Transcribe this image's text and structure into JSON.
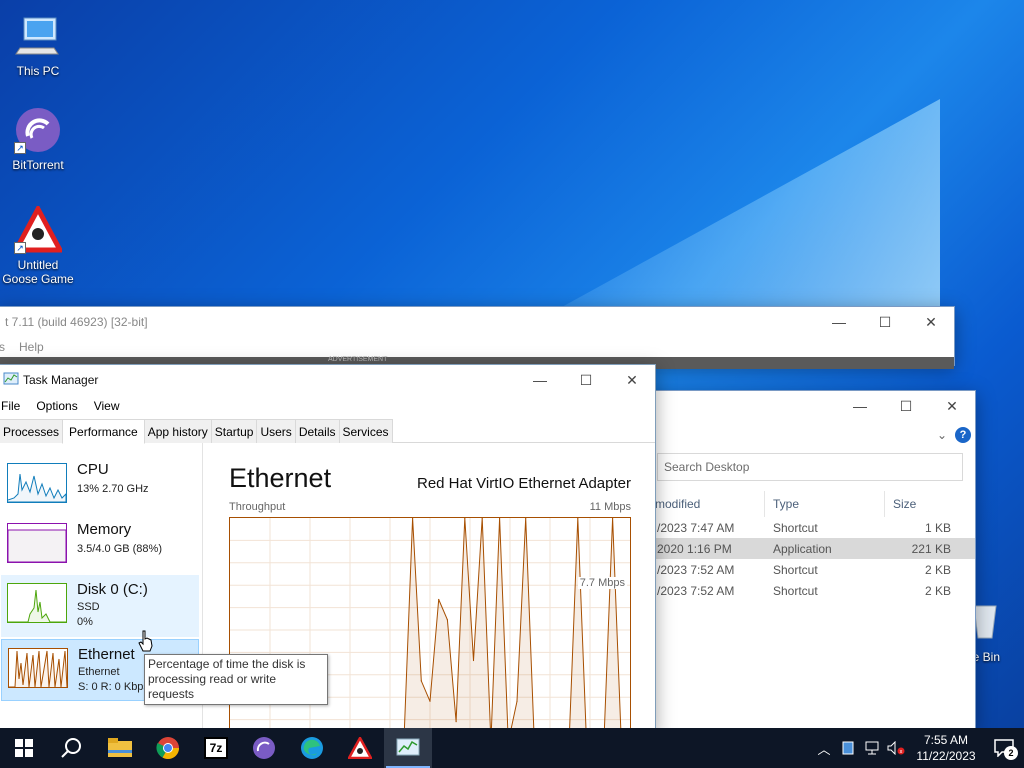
{
  "desktop": {
    "icons": [
      {
        "label": "This PC"
      },
      {
        "label": "BitTorrent"
      },
      {
        "label": "Untitled Goose Game"
      }
    ],
    "recycle_label": "le Bin"
  },
  "zip_window": {
    "title": "t 7.11  (build 46923) [32-bit]",
    "menu": [
      "s",
      "Help"
    ],
    "ad_label": "ADVERTISEMENT"
  },
  "explorer": {
    "search_placeholder": "Search Desktop",
    "columns": {
      "modified": "modified",
      "type": "Type",
      "size": "Size"
    },
    "rows": [
      {
        "modified": "/2023 7:47 AM",
        "type": "Shortcut",
        "size": "1 KB",
        "selected": false
      },
      {
        "modified": "2020 1:16 PM",
        "type": "Application",
        "size": "221 KB",
        "selected": true
      },
      {
        "modified": "/2023 7:52 AM",
        "type": "Shortcut",
        "size": "2 KB",
        "selected": false
      },
      {
        "modified": "/2023 7:52 AM",
        "type": "Shortcut",
        "size": "2 KB",
        "selected": false
      }
    ]
  },
  "task_manager": {
    "title": "Task Manager",
    "menu": {
      "file": "File",
      "options": "Options",
      "view": "View"
    },
    "tabs": [
      "Processes",
      "Performance",
      "App history",
      "Startup",
      "Users",
      "Details",
      "Services"
    ],
    "active_tab": "Performance",
    "sidebar": {
      "cpu": {
        "title": "CPU",
        "line1": "13%  2.70 GHz"
      },
      "memory": {
        "title": "Memory",
        "line1": "3.5/4.0 GB (88%)"
      },
      "disk": {
        "title": "Disk 0 (C:)",
        "line1": "SSD",
        "line2": "0%"
      },
      "ethernet": {
        "title": "Ethernet",
        "line1": "Ethernet",
        "line2": "S: 0  R: 0 Kbps"
      }
    },
    "main": {
      "title": "Ethernet",
      "adapter": "Red Hat VirtIO Ethernet Adapter",
      "graph_label": "Throughput",
      "graph_max": "11 Mbps",
      "graph_mid": "7.7 Mbps"
    },
    "tooltip": "Percentage of time the disk is processing read or write requests"
  },
  "chart_data": {
    "type": "area",
    "title": "Ethernet",
    "ylabel": "Throughput",
    "ylim": [
      0,
      11
    ],
    "y_unit": "Mbps",
    "series": [
      {
        "name": "Throughput",
        "values": [
          0,
          0,
          0,
          0,
          0,
          0,
          0,
          0,
          0,
          0,
          0,
          0,
          0,
          0,
          0,
          0,
          0,
          0,
          0,
          0,
          0,
          11,
          3,
          2,
          7,
          6,
          1,
          11,
          4,
          11,
          0,
          11,
          0,
          2,
          11,
          0,
          0,
          0,
          0,
          0,
          11,
          0,
          0,
          0,
          11,
          0,
          0
        ]
      }
    ]
  },
  "taskbar": {
    "apps": [
      "start",
      "search",
      "file-explorer",
      "chrome",
      "7zip",
      "bittorrent",
      "edge",
      "goose-game",
      "task-manager"
    ],
    "clock_time": "7:55 AM",
    "clock_date": "11/22/2023",
    "notifications": "2"
  },
  "colors": {
    "cpu": "#117dbb",
    "memory": "#8b12ae",
    "disk": "#4da60c",
    "ethernet": "#a74f01"
  }
}
